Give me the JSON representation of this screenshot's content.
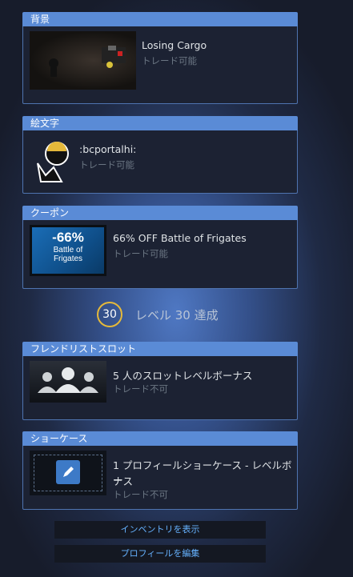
{
  "sections": {
    "background": {
      "header": "背景",
      "title": "Losing Cargo",
      "sub": "トレード可能"
    },
    "emoticon": {
      "header": "絵文字",
      "title": ":bcportalhi:",
      "sub": "トレード可能"
    },
    "coupon": {
      "header": "クーポン",
      "title": "66% OFF Battle of Frigates",
      "sub": "トレード可能",
      "thumb_pct": "-66%",
      "thumb_line1": "Battle of",
      "thumb_line2": "Frigates"
    },
    "friends": {
      "header": "フレンドリストスロット",
      "title": "5 人のスロットレベルボーナス",
      "sub": "トレード不可"
    },
    "showcase": {
      "header": "ショーケース",
      "title_line1": "1 プロフィールショーケース - レベルボー",
      "title_line2": "ナス",
      "sub": "トレード不可"
    }
  },
  "level": {
    "number": "30",
    "text": "レベル 30 達成"
  },
  "buttons": {
    "inventory": "インベントリを表示",
    "edit_profile": "プロフィールを編集"
  },
  "colors": {
    "header": "#5a8bd6",
    "gold": "#e5b93a",
    "link": "#66b2ff"
  }
}
